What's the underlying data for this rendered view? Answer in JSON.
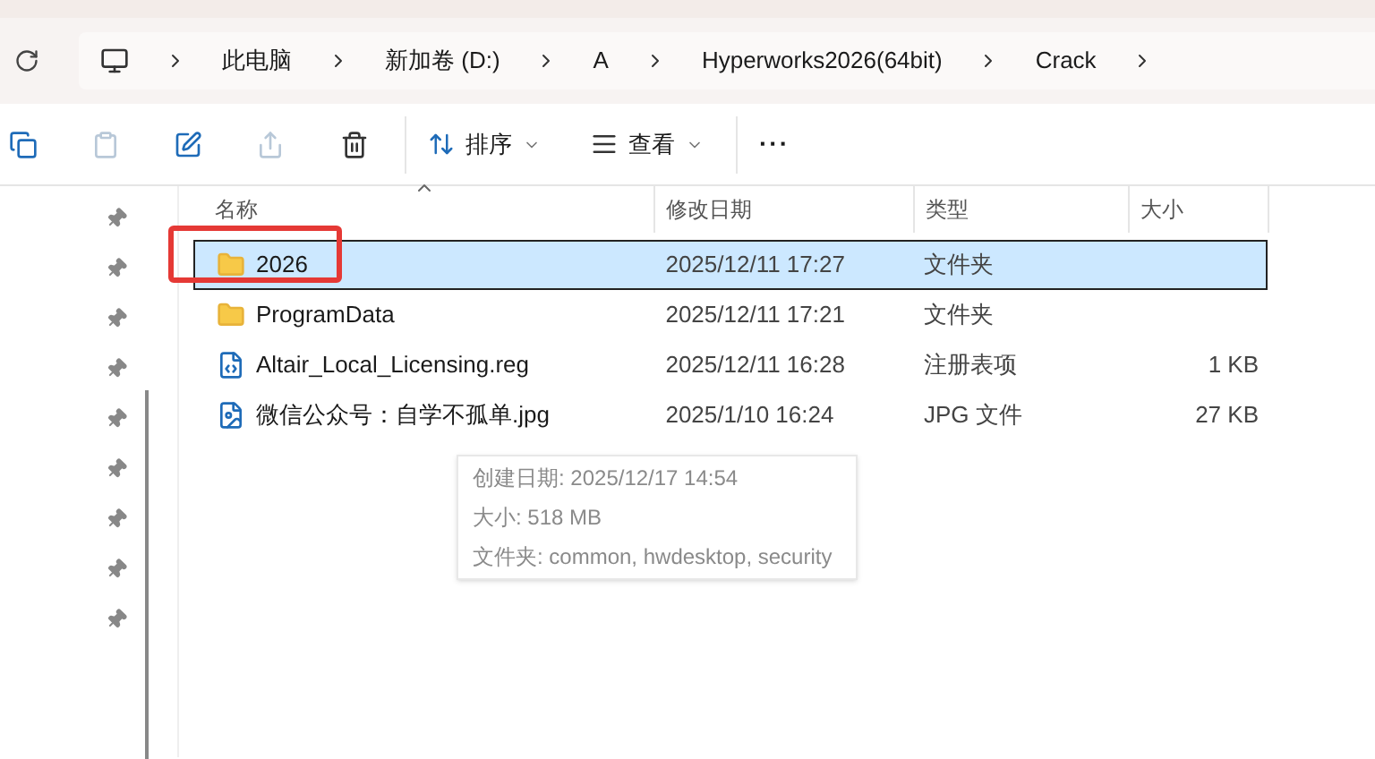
{
  "breadcrumb": [
    "此电脑",
    "新加卷 (D:)",
    "A",
    "Hyperworks2026(64bit)",
    "Crack"
  ],
  "toolbar": {
    "sort": "排序",
    "view": "查看",
    "more": "···"
  },
  "columns": [
    {
      "label": "名称",
      "sorted": true
    },
    {
      "label": "修改日期",
      "sorted": false
    },
    {
      "label": "类型",
      "sorted": false
    },
    {
      "label": "大小",
      "sorted": false
    }
  ],
  "rows": [
    {
      "kind": "folder",
      "name": "2026",
      "date": "2025/12/11 17:27",
      "type": "文件夹",
      "selected": true,
      "highlighted": true
    },
    {
      "kind": "folder",
      "name": "ProgramData",
      "date": "2025/12/11 17:21",
      "type": "文件夹",
      "selected": false,
      "highlighted": false
    },
    {
      "kind": "reg",
      "name": "Altair_Local_Licensing.reg",
      "date": "2025/12/11 16:28",
      "type": "注册表项",
      "size": "1 KB",
      "selected": false,
      "highlighted": false
    },
    {
      "kind": "image",
      "name": "微信公众号：自学不孤单.jpg",
      "date": "2025/1/10 16:24",
      "type": "JPG 文件",
      "size": "27 KB",
      "selected": false,
      "highlighted": false
    }
  ],
  "tooltip": [
    "创建日期: 2025/12/17 14:54",
    "大小: 518 MB",
    "文件夹: common, hwdesktop, security"
  ]
}
